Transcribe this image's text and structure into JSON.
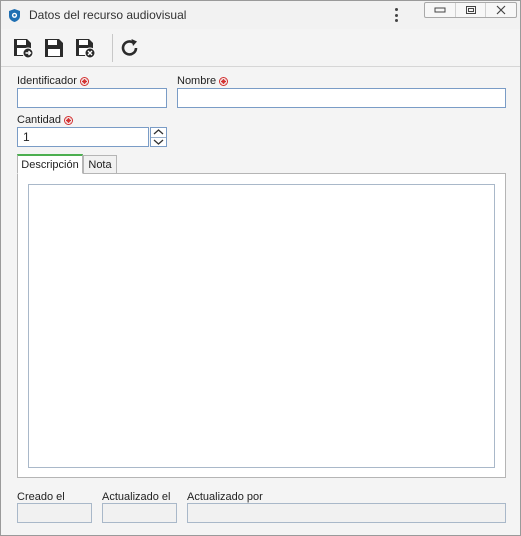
{
  "window": {
    "title": "Datos del recurso audiovisual",
    "icons": {
      "app": "app-shield-icon",
      "more": "more-vertical-icon",
      "minimize": "minimize-icon",
      "restore": "restore-icon",
      "close": "close-icon"
    }
  },
  "toolbar": {
    "buttons": [
      {
        "name": "save-and-new-button",
        "icon": "save-new-icon"
      },
      {
        "name": "save-button",
        "icon": "save-icon"
      },
      {
        "name": "save-and-close-button",
        "icon": "save-close-icon"
      },
      {
        "name": "refresh-button",
        "icon": "refresh-icon"
      }
    ]
  },
  "form": {
    "identificador": {
      "label": "Identificador",
      "value": ""
    },
    "nombre": {
      "label": "Nombre",
      "value": ""
    },
    "cantidad": {
      "label": "Cantidad",
      "value": "1"
    }
  },
  "tabs": [
    {
      "label": "Descripción",
      "active": true
    },
    {
      "label": "Nota",
      "active": false
    }
  ],
  "descripcion": {
    "value": ""
  },
  "footer": {
    "creado_el": {
      "label": "Creado el",
      "value": ""
    },
    "actualizado_el": {
      "label": "Actualizado el",
      "value": ""
    },
    "actualizado_por": {
      "label": "Actualizado por",
      "value": ""
    }
  },
  "colors": {
    "required": "#d32f2f",
    "input_border": "#7a9cc6",
    "active_tab": "#4caf50"
  }
}
